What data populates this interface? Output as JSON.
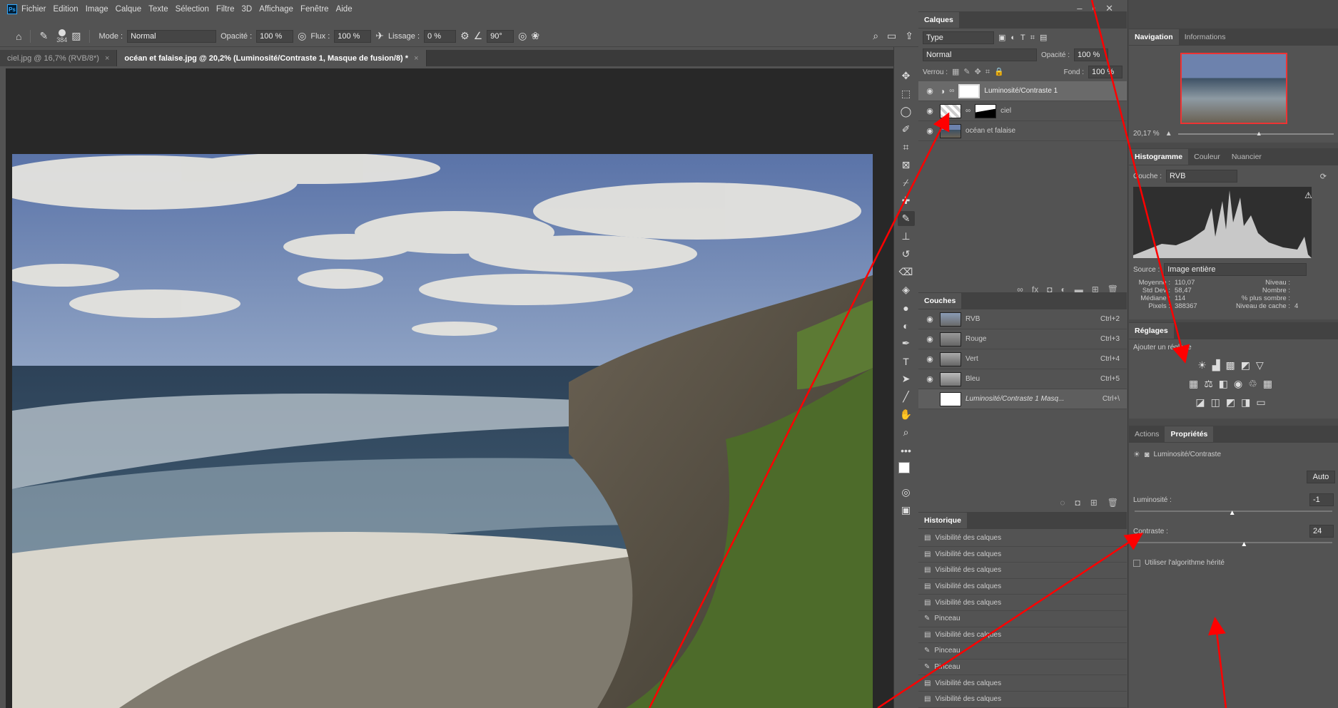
{
  "menubar": {
    "logo": "Ps",
    "items": [
      "Fichier",
      "Edition",
      "Image",
      "Calque",
      "Texte",
      "Sélection",
      "Filtre",
      "3D",
      "Affichage",
      "Fenêtre",
      "Aide"
    ]
  },
  "options": {
    "brush_size": "384",
    "mode_label": "Mode :",
    "mode_value": "Normal",
    "opacity_label": "Opacité :",
    "opacity_value": "100 %",
    "flow_label": "Flux :",
    "flow_value": "100 %",
    "smoothing_label": "Lissage :",
    "smoothing_value": "0 %",
    "angle_value": "90°"
  },
  "tabs": [
    {
      "label": "ciel.jpg @ 16,7% (RVB/8*)",
      "close": "×"
    },
    {
      "label": "océan et falaise.jpg @ 20,2% (Luminosité/Contraste 1, Masque de fusion/8) *",
      "close": "×"
    }
  ],
  "layers_panel": {
    "tab": "Calques",
    "filter_value": "Type",
    "blend_mode": "Normal",
    "opacity_label": "Opacité :",
    "opacity_value": "100 %",
    "lock_label": "Verrou :",
    "fill_label": "Fond :",
    "fill_value": "100 %",
    "layers": [
      {
        "name": "Luminosité/Contraste 1"
      },
      {
        "name": "ciel"
      },
      {
        "name": "océan et falaise"
      }
    ],
    "footer_fx": "fx"
  },
  "channels_panel": {
    "tab": "Couches",
    "channels": [
      {
        "name": "RVB",
        "shortcut": "Ctrl+2"
      },
      {
        "name": "Rouge",
        "shortcut": "Ctrl+3"
      },
      {
        "name": "Vert",
        "shortcut": "Ctrl+4"
      },
      {
        "name": "Bleu",
        "shortcut": "Ctrl+5"
      },
      {
        "name": "Luminosité/Contraste 1 Masq...",
        "shortcut": "Ctrl+\\"
      }
    ]
  },
  "history_panel": {
    "tab": "Historique",
    "items": [
      "Visibilité des calques",
      "Visibilité des calques",
      "Visibilité des calques",
      "Visibilité des calques",
      "Visibilité des calques",
      "Pinceau",
      "Visibilité des calques",
      "Pinceau",
      "Pinceau",
      "Visibilité des calques",
      "Visibilité des calques"
    ]
  },
  "navigator": {
    "tabs": [
      "Navigation",
      "Informations"
    ],
    "zoom": "20,17 %"
  },
  "histogram": {
    "tabs": [
      "Histogramme",
      "Couleur",
      "Nuancier"
    ],
    "channel_label": "Couche :",
    "channel_value": "RVB",
    "source_label": "Source :",
    "source_value": "Image entière",
    "stats_left": [
      {
        "label": "Moyenne :",
        "value": "110,07"
      },
      {
        "label": "Std Dev :",
        "value": "58,47"
      },
      {
        "label": "Médiane :",
        "value": "114"
      },
      {
        "label": "Pixels :",
        "value": "388367"
      }
    ],
    "stats_right": [
      {
        "label": "Niveau :",
        "value": ""
      },
      {
        "label": "Nombre :",
        "value": ""
      },
      {
        "label": "% plus sombre :",
        "value": ""
      },
      {
        "label": "Niveau de cache :",
        "value": "4"
      }
    ]
  },
  "adjustments": {
    "tab": "Réglages",
    "add_label": "Ajouter un réglage"
  },
  "properties": {
    "tabs": [
      "Actions",
      "Propriétés"
    ],
    "title": "Luminosité/Contraste",
    "auto_label": "Auto",
    "brightness_label": "Luminosité :",
    "brightness_value": "-1",
    "brightness_level": 0.49,
    "contrast_label": "Contraste :",
    "contrast_value": "24",
    "contrast_level": 0.55,
    "legacy_label": "Utiliser l'algorithme hérité"
  },
  "colors": {
    "annotation": "#ff0000",
    "selected_row": "#6a6a6a"
  }
}
